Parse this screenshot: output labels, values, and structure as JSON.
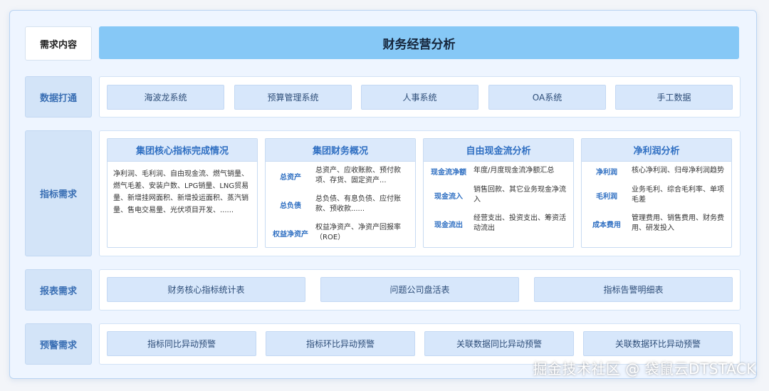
{
  "title": "财务经营分析",
  "rows": {
    "content": "需求内容",
    "data": "数据打通",
    "indicator": "指标需求",
    "report": "报表需求",
    "warning": "预警需求"
  },
  "data_systems": [
    "海波龙系统",
    "预算管理系统",
    "人事系统",
    "OA系统",
    "手工数据"
  ],
  "cards": {
    "core": {
      "title": "集团核心指标完成情况",
      "body": "净利润、毛利润、自由现金流、燃气销量、燃气毛差、安装户数、LPG销量、LNG贸易量、新增挂网面积、新增投运面积、蒸汽销量、售电交易量、光伏项目开发、......"
    },
    "overview": {
      "title": "集团财务概况",
      "items": [
        {
          "k": "总资产",
          "v": "总资产、应收账款、预付款项、存货、固定资产..."
        },
        {
          "k": "总负债",
          "v": "总负债、有息负债、应付账款、预收款......"
        },
        {
          "k": "权益净资产",
          "v": "权益净资产、净资产回报率（ROE）"
        }
      ]
    },
    "cashflow": {
      "title": "自由现金流分析",
      "items": [
        {
          "k": "现金流净额",
          "v": "年度/月度现金流净额汇总"
        },
        {
          "k": "现金流入",
          "v": "销售回款、其它业务现金净流入"
        },
        {
          "k": "现金流出",
          "v": "经营支出、投资支出、筹资活动流出"
        }
      ]
    },
    "profit": {
      "title": "净利润分析",
      "items": [
        {
          "k": "净利润",
          "v": "核心净利润、归母净利润趋势"
        },
        {
          "k": "毛利润",
          "v": "业务毛利、综合毛利率、单项毛差"
        },
        {
          "k": "成本费用",
          "v": "管理费用、销售费用、财务费用、研发投入"
        }
      ]
    }
  },
  "reports": [
    "财务核心指标统计表",
    "问题公司盘活表",
    "指标告警明细表"
  ],
  "warnings": [
    "指标同比异动预警",
    "指标环比异动预警",
    "关联数据同比异动预警",
    "关联数据环比异动预警"
  ],
  "watermark": "掘金技术社区 @ 袋鼠云DTSTACK"
}
